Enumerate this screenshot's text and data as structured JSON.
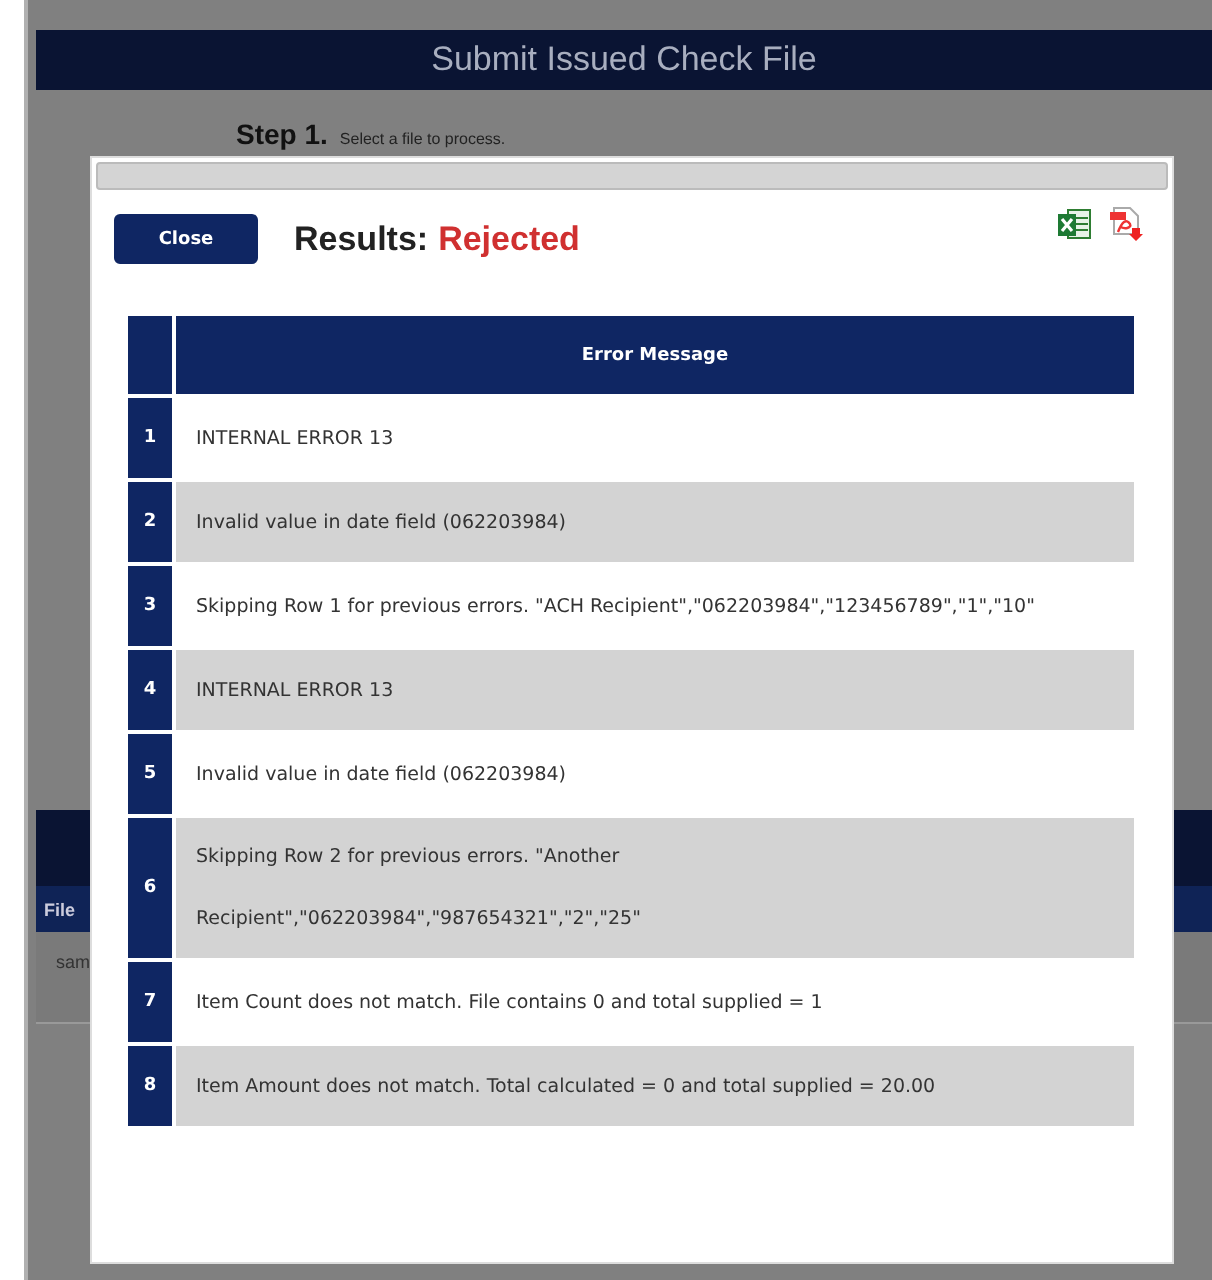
{
  "page": {
    "title": "Submit Issued Check File",
    "step": {
      "label": "Step 1.",
      "text": "Select a file to process."
    },
    "files_header": "File",
    "files_row": "sam"
  },
  "modal": {
    "close_button": "Close",
    "results_label": "Results:",
    "results_status": "Rejected",
    "table": {
      "columns": [
        "Error Message"
      ],
      "rows": [
        {
          "number": "1",
          "lines": [
            "INTERNAL ERROR 13"
          ]
        },
        {
          "number": "2",
          "lines": [
            "Invalid value in date field (062203984)"
          ]
        },
        {
          "number": "3",
          "lines": [
            "Skipping Row 1 for previous errors. \"ACH Recipient\",\"062203984\",\"123456789\",\"1\",\"10\""
          ]
        },
        {
          "number": "4",
          "lines": [
            "INTERNAL ERROR 13"
          ]
        },
        {
          "number": "5",
          "lines": [
            "Invalid value in date field (062203984)"
          ]
        },
        {
          "number": "6",
          "lines": [
            "Skipping Row 2 for previous errors. \"Another",
            "Recipient\",\"062203984\",\"987654321\",\"2\",\"25\""
          ]
        },
        {
          "number": "7",
          "lines": [
            "Item Count does not match. File contains 0 and total supplied = 1"
          ]
        },
        {
          "number": "8",
          "lines": [
            "Item Amount does not match. Total calculated = 0 and total supplied = 20.00"
          ]
        }
      ]
    }
  }
}
